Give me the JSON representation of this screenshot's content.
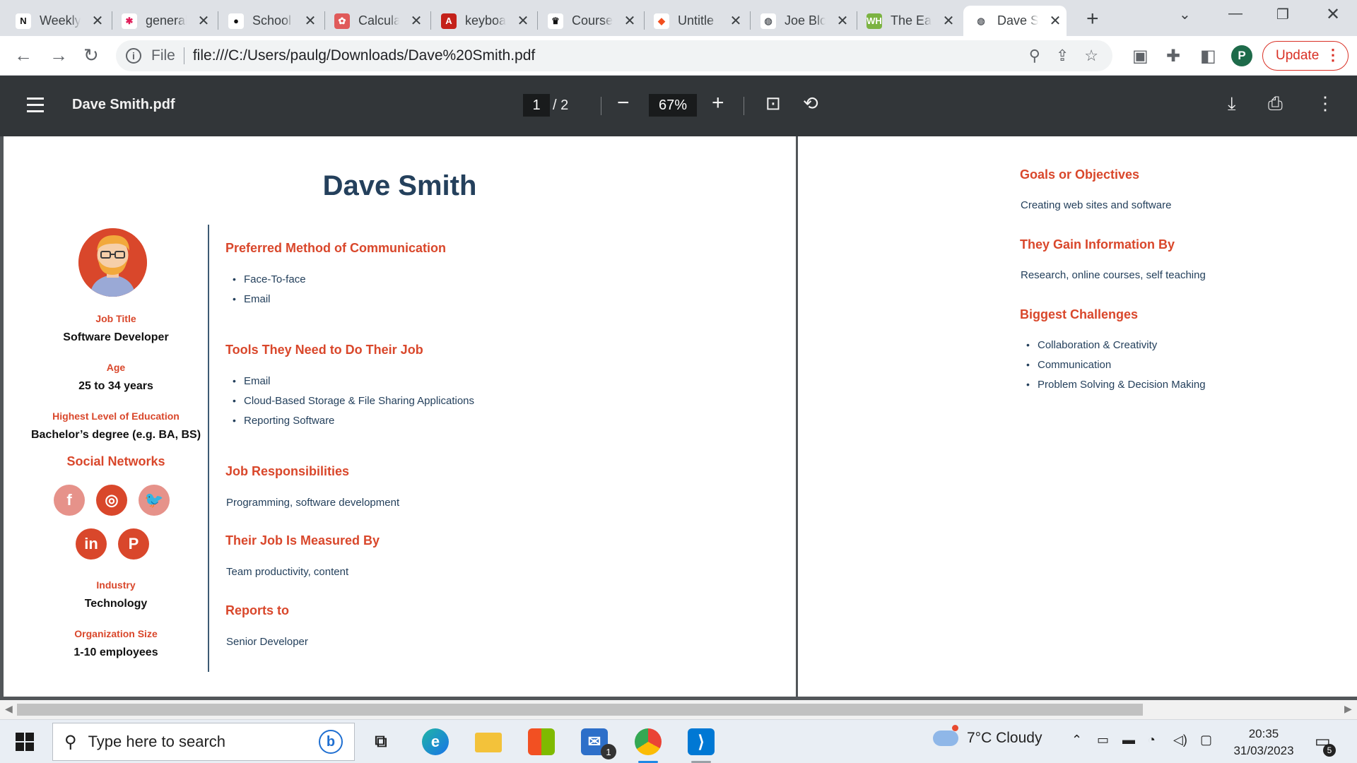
{
  "tabs": [
    {
      "title": "Weekly",
      "icon": "notion-icon",
      "glyph": "N",
      "bg": "#ffffff",
      "fg": "#111111"
    },
    {
      "title": "general",
      "icon": "slack-icon",
      "glyph": "✱",
      "bg": "#ffffff",
      "fg": "#e01e5a"
    },
    {
      "title": "School",
      "icon": "github-icon",
      "glyph": "●",
      "bg": "#ffffff",
      "fg": "#111111"
    },
    {
      "title": "Calcula",
      "icon": "openai-icon",
      "glyph": "✿",
      "bg": "#e05a5a",
      "fg": "#ffffff"
    },
    {
      "title": "keyboa",
      "icon": "acrobat-icon",
      "glyph": "A",
      "bg": "#c4211a",
      "fg": "#ffffff"
    },
    {
      "title": "Course",
      "icon": "crown-icon",
      "glyph": "♛",
      "bg": "#ffffff",
      "fg": "#111111"
    },
    {
      "title": "Untitle",
      "icon": "figma-icon",
      "glyph": "◆",
      "bg": "#ffffff",
      "fg": "#f24e1e"
    },
    {
      "title": "Joe Blo",
      "icon": "globe-icon",
      "glyph": "◍",
      "bg": "#ffffff",
      "fg": "#5f6368"
    },
    {
      "title": "The Ea",
      "icon": "wh-icon",
      "glyph": "WH",
      "bg": "#7cb342",
      "fg": "#ffffff"
    },
    {
      "title": "Dave S",
      "icon": "globe-icon",
      "glyph": "◍",
      "bg": "#ffffff",
      "fg": "#5f6368"
    }
  ],
  "address": {
    "scheme_label": "File",
    "url": "file:///C:/Users/paulg/Downloads/Dave%20Smith.pdf"
  },
  "profile_initial": "P",
  "update_label": "Update",
  "pdf": {
    "filename": "Dave Smith.pdf",
    "current_page": "1",
    "total_pages": "/  2",
    "zoom": "67%"
  },
  "persona": {
    "name": "Dave Smith",
    "fields": [
      {
        "label": "Job Title",
        "value": "Software Developer"
      },
      {
        "label": "Age",
        "value": "25 to 34 years"
      },
      {
        "label": "Highest Level of Education",
        "value": "Bachelor’s degree (e.g. BA, BS)"
      }
    ],
    "social_heading": "Social Networks",
    "social": [
      {
        "name": "facebook-icon",
        "glyph": "f",
        "color": "#e6928a"
      },
      {
        "name": "instagram-icon",
        "glyph": "◎",
        "color": "#d9472b"
      },
      {
        "name": "twitter-icon",
        "glyph": "🐦",
        "color": "#e6928a"
      },
      {
        "name": "linkedin-icon",
        "glyph": "in",
        "color": "#d9472b"
      },
      {
        "name": "pinterest-icon",
        "glyph": "P",
        "color": "#d9472b"
      }
    ],
    "fields_bottom": [
      {
        "label": "Industry",
        "value": "Technology"
      },
      {
        "label": "Organization Size",
        "value": "1-10 employees"
      }
    ],
    "sections": {
      "communication": {
        "heading": "Preferred Method of Communication",
        "items": [
          "Face-To-face",
          "Email"
        ]
      },
      "tools": {
        "heading": "Tools They Need to Do Their Job",
        "items": [
          "Email",
          "Cloud-Based Storage & File Sharing Applications",
          "Reporting Software"
        ]
      },
      "responsibilities": {
        "heading": "Job Responsibilities",
        "text": "Programming, software development"
      },
      "measured": {
        "heading": "Their Job Is Measured By",
        "text": "Team productivity, content"
      },
      "reports": {
        "heading": "Reports to",
        "text": "Senior Developer"
      },
      "goals": {
        "heading": "Goals or Objectives",
        "text": "Creating web sites and software"
      },
      "info": {
        "heading": "They Gain Information By",
        "text": "Research, online courses, self teaching"
      },
      "challenges": {
        "heading": "Biggest Challenges",
        "items": [
          "Collaboration & Creativity",
          "Communication",
          "Problem Solving & Decision Making"
        ]
      }
    }
  },
  "taskbar": {
    "search_placeholder": "Type here to search",
    "mail_badge": "1",
    "weather": "7°C  Cloudy",
    "time": "20:35",
    "date": "31/03/2023",
    "notifications": "5"
  },
  "colors": {
    "accent": "#d9472b",
    "heading": "#24405c",
    "viewer_bar": "#323639"
  }
}
